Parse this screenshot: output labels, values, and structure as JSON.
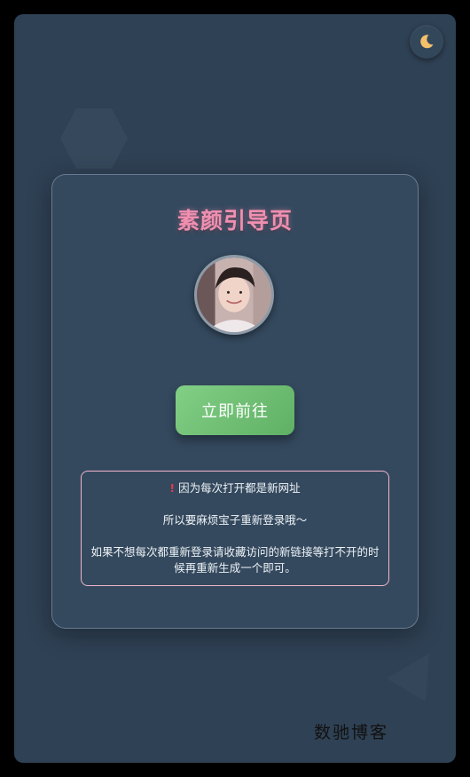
{
  "page": {
    "title": "素颜引导页",
    "button_label": "立即前往",
    "notice": {
      "warn_icon": "!",
      "line1": "因为每次打开都是新网址",
      "line2": "所以要麻烦宝子重新登录哦～",
      "line3": "如果不想每次都重新登录请收藏访问的新链接等打不开的时候再重新生成一个即可。"
    }
  },
  "theme_toggle": {
    "icon": "moon-icon"
  },
  "avatar": {
    "alt": "avatar"
  },
  "watermark": "数驰博客",
  "colors": {
    "screen_bg": "#2f4154",
    "card_bg": "#34495e",
    "title_pink": "#f08fb0",
    "button_green": "#6dbf72",
    "notice_border": "#f1b6cc",
    "warn_red": "#e53950"
  }
}
